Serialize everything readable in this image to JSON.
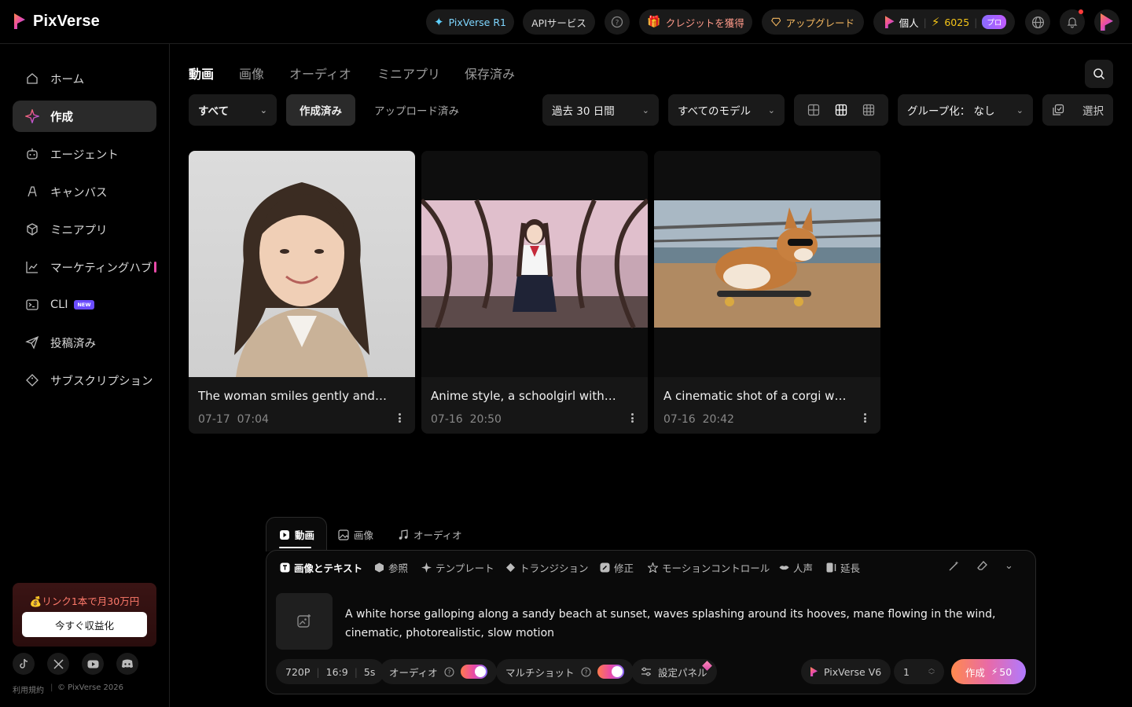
{
  "brand": {
    "name": "PixVerse",
    "accent_pink": "#e84aa8",
    "accent_orange": "#ff8a4d",
    "accent_purple": "#8a6bff"
  },
  "header": {
    "r1_label": "PixVerse R1",
    "api_label": "APIサービス",
    "credits_label": "クレジットを獲得",
    "upgrade_label": "アップグレード",
    "account_label": "個人",
    "credit_count": "6025",
    "plan_badge": "プロ"
  },
  "sidebar": {
    "items": [
      {
        "label": "ホーム",
        "icon": "home-icon"
      },
      {
        "label": "作成",
        "icon": "sparkle-icon"
      },
      {
        "label": "エージェント",
        "icon": "robot-icon"
      },
      {
        "label": "キャンバス",
        "icon": "canvas-icon"
      },
      {
        "label": "ミニアプリ",
        "icon": "cube-icon"
      },
      {
        "label": "マーケティングハブ",
        "icon": "chart-line-icon"
      },
      {
        "label": "CLI",
        "icon": "terminal-icon",
        "badge": "NEW"
      },
      {
        "label": "投稿済み",
        "icon": "send-icon"
      },
      {
        "label": "サブスクリプション",
        "icon": "diamond-icon"
      }
    ],
    "promo": {
      "title": "💰リンク1本で月30万円",
      "button": "今すぐ収益化"
    },
    "footer": {
      "terms": "利用規約",
      "copyright": "© PixVerse 2026"
    }
  },
  "main": {
    "tabs": [
      "動画",
      "画像",
      "オーディオ",
      "ミニアプリ",
      "保存済み"
    ],
    "filters": {
      "type": "すべて",
      "created": "作成済み",
      "uploaded": "アップロード済み",
      "period": "過去 30 日間",
      "models": "すべてのモデル",
      "group": "グループ化： なし",
      "select": "選択"
    },
    "cards": [
      {
        "title": "The woman smiles gently and t...",
        "date": "07-17",
        "time": "07:04"
      },
      {
        "title": "Anime style, a schoolgirl with_...",
        "date": "07-16",
        "time": "20:50"
      },
      {
        "title": "A cinematic shot of a corgi we...",
        "date": "07-16",
        "time": "20:42"
      }
    ]
  },
  "composer": {
    "tabs": [
      "動画",
      "画像",
      "オーディオ"
    ],
    "modes": [
      "画像とテキスト",
      "参照",
      "テンプレート",
      "トランジション",
      "修正",
      "モーションコントロール",
      "人声",
      "延長"
    ],
    "prompt": "A white horse galloping along a sandy beach at sunset, waves splashing around its hooves, mane flowing in the wind, cinematic, photorealistic, slow motion",
    "resolution": "720P",
    "ratio": "16:9",
    "duration": "5s",
    "audio_label": "オーディオ",
    "multishot_label": "マルチショット",
    "settings_label": "設定パネル",
    "model": "PixVerse V6",
    "count": "1",
    "create_label": "作成",
    "create_cost": "50"
  }
}
